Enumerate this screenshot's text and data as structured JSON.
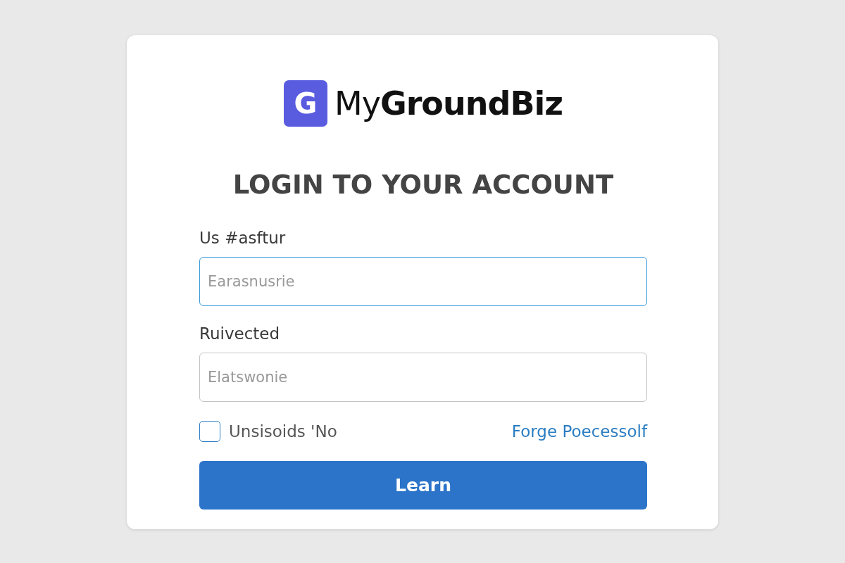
{
  "logo": {
    "mark": "G",
    "name": "My**GroundBiz**"
  },
  "title": "LOGIN TO YOUR ACCOUNT",
  "fields": [
    {
      "label": "Us #asftur",
      "placeholder": "Earasnusrie",
      "focused": true
    },
    {
      "label": "Ruivected",
      "placeholder": "Elatswonie",
      "focused": false
    }
  ],
  "remember": {
    "label": "Unsisoids 'No",
    "checked": false
  },
  "forgot_link": "Forge Poecessolf",
  "submit": "Learn"
}
